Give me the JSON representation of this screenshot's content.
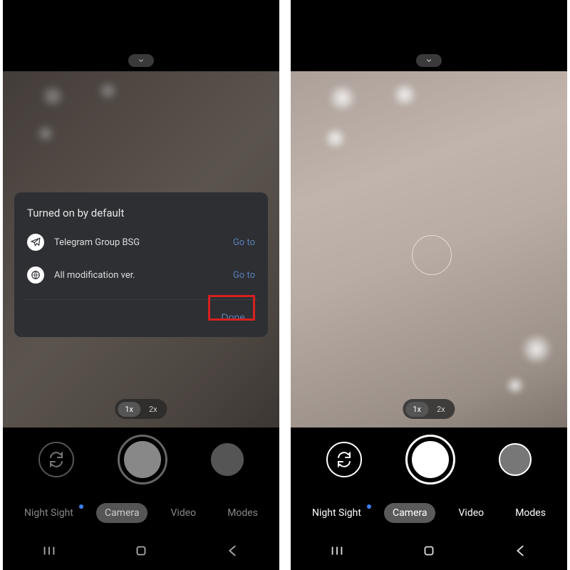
{
  "left": {
    "dialog": {
      "title": "Turned on by default",
      "rows": [
        {
          "label": "Telegram Group BSG",
          "action": "Go to"
        },
        {
          "label": "All modification ver.",
          "action": "Go to"
        }
      ],
      "done": "Done"
    },
    "zoom": {
      "opt1": "1x",
      "opt2": "2x"
    },
    "modes": {
      "night": "Night Sight",
      "camera": "Camera",
      "video": "Video",
      "more": "Modes"
    }
  },
  "right": {
    "zoom": {
      "opt1": "1x",
      "opt2": "2x"
    },
    "modes": {
      "night": "Night Sight",
      "camera": "Camera",
      "video": "Video",
      "more": "Modes"
    }
  }
}
